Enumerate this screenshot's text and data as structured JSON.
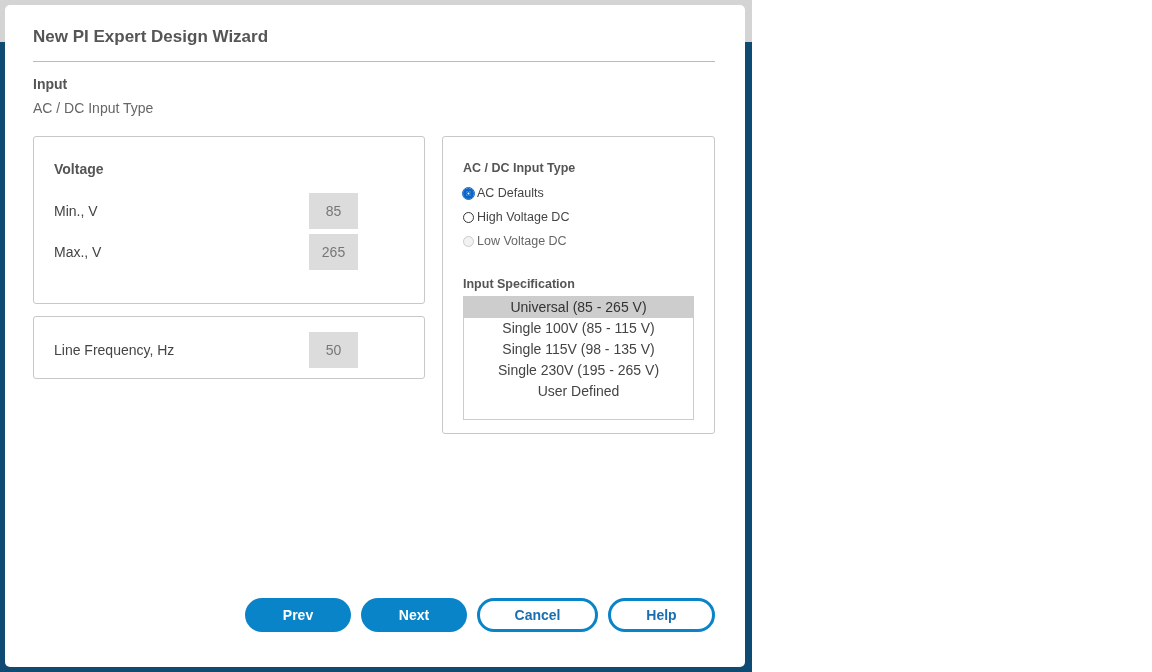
{
  "dialog": {
    "title": "New PI Expert Design Wizard",
    "section": "Input",
    "subtitle": "AC / DC Input Type"
  },
  "voltage": {
    "title": "Voltage",
    "fields": [
      {
        "label": "Min., V",
        "value": "85",
        "disabled": true
      },
      {
        "label": "Max., V",
        "value": "265",
        "disabled": true
      }
    ]
  },
  "frequency": {
    "label": "Line Frequency, Hz",
    "value": "50",
    "disabled": true
  },
  "input_type": {
    "title": "AC / DC Input Type",
    "options": [
      {
        "label": "AC Defaults",
        "selected": true,
        "disabled": false
      },
      {
        "label": "High Voltage DC",
        "selected": false,
        "disabled": false
      },
      {
        "label": "Low Voltage DC",
        "selected": false,
        "disabled": true
      }
    ]
  },
  "input_specification": {
    "title": "Input Specification",
    "items": [
      {
        "label": "Universal (85 - 265 V)",
        "selected": true
      },
      {
        "label": "Single 100V (85 - 115 V)",
        "selected": false
      },
      {
        "label": "Single 115V (98 - 135 V)",
        "selected": false
      },
      {
        "label": "Single 230V (195 - 265 V)",
        "selected": false
      },
      {
        "label": "User Defined",
        "selected": false
      }
    ]
  },
  "buttons": [
    {
      "label": "Prev",
      "kind": "primary"
    },
    {
      "label": "Next",
      "kind": "primary"
    },
    {
      "label": "Cancel",
      "kind": "outline"
    },
    {
      "label": "Help",
      "kind": "outline"
    }
  ]
}
